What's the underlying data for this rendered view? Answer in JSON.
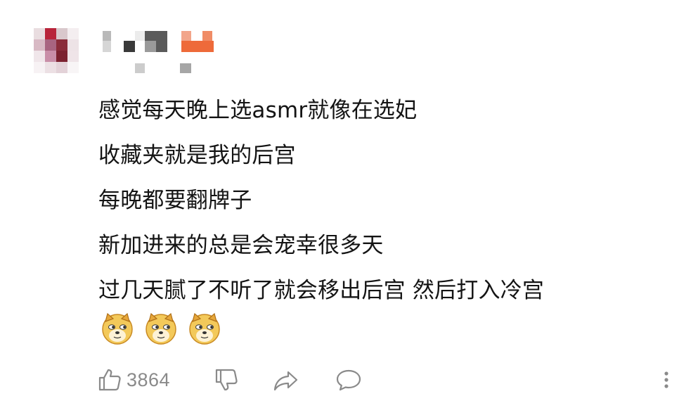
{
  "comment": {
    "lines": [
      "感觉每天晚上选asmr就像在选妃",
      "收藏夹就是我的后宫",
      "每晚都要翻牌子",
      "新加进来的总是会宠幸很多天",
      "过几天腻了不听了就会移出后宫 然后打入冷宫"
    ],
    "emojis": [
      "doge",
      "doge",
      "doge"
    ]
  },
  "actions": {
    "like_count": "3864",
    "like_icon": "thumbs-up-icon",
    "dislike_icon": "thumbs-down-icon",
    "share_icon": "share-arrow-icon",
    "reply_icon": "speech-bubble-icon",
    "more_icon": "more-vertical-icon"
  },
  "colors": {
    "text": "#141414",
    "icon": "#8a8a8a",
    "username_accent": "#ee6a3a"
  }
}
